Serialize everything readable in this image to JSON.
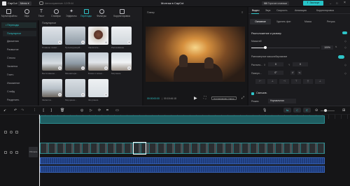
{
  "app": {
    "name": "CapCut",
    "menu_label": "Меню",
    "autosave": "Автосохранение: 12:09:44",
    "window_title": "Монтаж в CapCut",
    "shortcuts_label": "Горячие клавиши",
    "export_label": "Экспорт"
  },
  "toolbar": [
    {
      "label": "Мультифайлы",
      "icon": "folder-icon"
    },
    {
      "label": "Звук",
      "icon": "music-icon"
    },
    {
      "label": "Текст",
      "icon": "text-icon"
    },
    {
      "label": "Стикеры",
      "icon": "sticker-icon"
    },
    {
      "label": "Эффекты",
      "icon": "effects-icon"
    },
    {
      "label": "Переходы",
      "icon": "transitions-icon"
    },
    {
      "label": "Фильтры",
      "icon": "filters-icon"
    },
    {
      "label": "Корректировка",
      "icon": "adjust-icon"
    }
  ],
  "leftnav": {
    "header": "• Переходы",
    "items": [
      "Популярное",
      "Движения",
      "Размытие",
      "Стекло",
      "Засветка",
      "Глитч",
      "Искажение",
      "Слайд",
      "Разделить"
    ],
    "active_index": 0
  },
  "media": {
    "section": "Популярное",
    "items": [
      {
        "caption": "Плавное появл..."
      },
      {
        "caption": "Пульсирующий..."
      },
      {
        "caption": "Увеличить..."
      },
      {
        "caption": "Рассеивание"
      },
      {
        "caption": "Вытягивание..."
      },
      {
        "caption": "Миниатюра..."
      },
      {
        "caption": "Блики и затем..."
      },
      {
        "caption": "Моргание"
      },
      {
        "caption": "Засветка..."
      },
      {
        "caption": "Мерцание..."
      },
      {
        "caption": "Затухание"
      }
    ]
  },
  "player": {
    "title": "Плеер",
    "time_current": "00:00:00:00",
    "time_total": "00:15:46:18",
    "ratio_label": "Соотношение сторон"
  },
  "inspector": {
    "tabs": [
      "Видео",
      "Звук",
      "Скорость",
      "Анимация",
      "Корректировка"
    ],
    "subtabs": [
      "Основное",
      "Удалить фон",
      "Маска",
      "Ретушь"
    ],
    "section_title": "Расположение и размер",
    "scale_label": "Масштаб",
    "scale_value": "100%",
    "uniform_label": "Равномерное масштабирование",
    "position_label": "Располо...",
    "position_x_label": "X",
    "position_x": "0",
    "position_y_label": "Y",
    "position_y": "0",
    "rotate_label": "Поверн...",
    "rotate_value": "0°",
    "blend_title": "Смешив.",
    "blend_mode_label": "Режим",
    "blend_mode_value": "Нормальная"
  },
  "timeline": {
    "cover_label": "Обложка"
  },
  "colors": {
    "accent": "#2ec5c9",
    "export": "#27c4c8",
    "audio": "#2a4f9a",
    "video": "#1f6f72"
  }
}
